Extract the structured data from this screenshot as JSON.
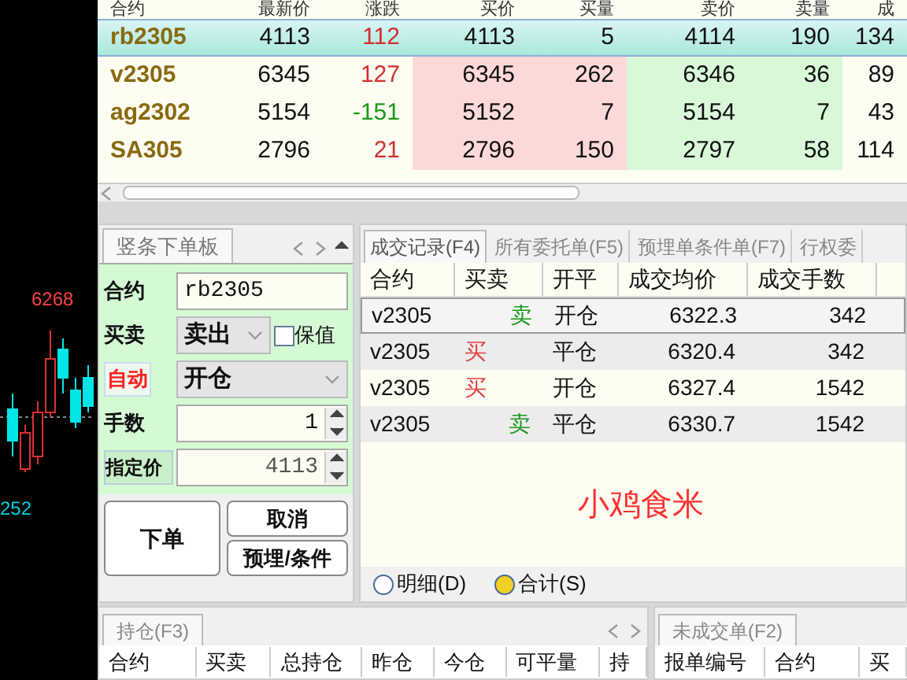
{
  "quote_table": {
    "columns": [
      "合约",
      "最新价",
      "涨跌",
      "买价",
      "买量",
      "卖价",
      "卖量",
      "成"
    ],
    "rows": [
      {
        "cells": [
          "rb2305",
          "4113",
          "112",
          "4113",
          "5",
          "4114",
          "190",
          "134"
        ],
        "kind": "up",
        "selected": true
      },
      {
        "cells": [
          "v2305",
          "6345",
          "127",
          "6345",
          "262",
          "6346",
          "36",
          "89"
        ],
        "kind": "up",
        "selected": false
      },
      {
        "cells": [
          "ag2302",
          "5154",
          "-151",
          "5152",
          "7",
          "5154",
          "7",
          "43"
        ],
        "kind": "down",
        "selected": false
      },
      {
        "cells": [
          "SA305",
          "2796",
          "21",
          "2796",
          "150",
          "2797",
          "58",
          "114"
        ],
        "kind": "up",
        "selected": false
      }
    ]
  },
  "chart": {
    "high_label": "6268",
    "low_label": "252"
  },
  "order_panel": {
    "tab": "竖条下单板",
    "contract": {
      "label": "合约",
      "value": "rb2305"
    },
    "side": {
      "label": "买卖",
      "value": "卖出"
    },
    "hedge": {
      "label": "保值",
      "checked": false
    },
    "auto": {
      "label": "自动",
      "on": true
    },
    "open_close": {
      "value": "开仓"
    },
    "lots": {
      "label": "手数",
      "value": "1"
    },
    "price": {
      "label": "指定价",
      "value": "4113"
    },
    "buttons": [
      "下单",
      "取消",
      "预埋/条件"
    ]
  },
  "trades": {
    "tabs": [
      {
        "label": "成交记录(F4)",
        "selected": true
      },
      {
        "label": "所有委托单(F5)",
        "selected": false
      },
      {
        "label": "预埋单条件单(F7)",
        "selected": false
      },
      {
        "label": "行权委",
        "selected": false
      }
    ],
    "columns": [
      "合约",
      "买卖",
      "开平",
      "成交均价",
      "成交手数"
    ],
    "rows": [
      {
        "contract": "v2305",
        "side": "卖",
        "kind": "sell",
        "offset": "开仓",
        "price": "6322.3",
        "lots": "342",
        "selected": true
      },
      {
        "contract": "v2305",
        "side": "买",
        "kind": "buy",
        "offset": "平仓",
        "price": "6320.4",
        "lots": "342",
        "selected": false
      },
      {
        "contract": "v2305",
        "side": "买",
        "kind": "buy",
        "offset": "开仓",
        "price": "6327.4",
        "lots": "1542",
        "selected": false
      },
      {
        "contract": "v2305",
        "side": "卖",
        "kind": "sell",
        "offset": "平仓",
        "price": "6330.7",
        "lots": "1542",
        "selected": false
      }
    ],
    "annotation": "小鸡食米",
    "radios": [
      {
        "label": "明细(D)",
        "selected": false
      },
      {
        "label": "合计(S)",
        "selected": true
      }
    ]
  },
  "positions": {
    "tab": "持仓(F3)",
    "columns": [
      "合约",
      "买卖",
      "总持仓",
      "昨仓",
      "今仓",
      "可平量",
      "持"
    ]
  },
  "pending": {
    "tab": "未成交单(F2)",
    "columns": [
      "报单编号",
      "合约",
      "买"
    ]
  }
}
